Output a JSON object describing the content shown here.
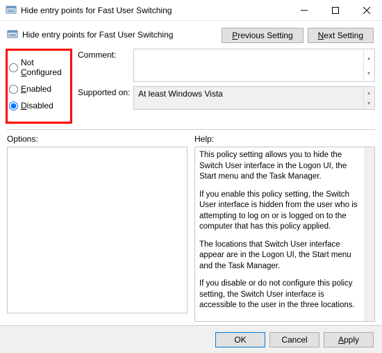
{
  "window": {
    "title": "Hide entry points for Fast User Switching"
  },
  "header": {
    "title": "Hide entry points for Fast User Switching",
    "prev_btn": "Previous Setting",
    "next_btn": "Next Setting"
  },
  "radios": {
    "not_configured": "Not Configured",
    "enabled": "Enabled",
    "disabled": "Disabled",
    "selected": "disabled"
  },
  "fields": {
    "comment_label": "Comment:",
    "comment_value": "",
    "supported_label": "Supported on:",
    "supported_value": "At least Windows Vista"
  },
  "lower": {
    "options_label": "Options:",
    "help_label": "Help:"
  },
  "help_paragraphs": [
    "This policy setting allows you to hide the Switch User interface in the Logon UI, the Start menu and the Task Manager.",
    "If you enable this policy setting, the Switch User interface is hidden from the user who is attempting to log on or is logged on to the computer that has this policy applied.",
    "The locations that Switch User interface appear are in the Logon UI, the Start menu and the Task Manager.",
    "If you disable or do not configure this policy setting, the Switch User interface is accessible to the user in the three locations."
  ],
  "footer": {
    "ok": "OK",
    "cancel": "Cancel",
    "apply": "Apply"
  }
}
